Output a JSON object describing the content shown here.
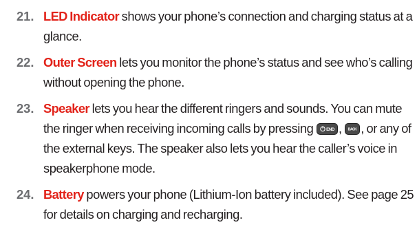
{
  "items": [
    {
      "number": "21.",
      "term": "LED Indicator",
      "text": " shows your phone’s connection and charging status at a glance."
    },
    {
      "number": "22.",
      "term": "Outer Screen",
      "text": " lets you monitor the phone’s status and see who’s calling without opening the phone."
    },
    {
      "number": "23.",
      "term": "Speaker",
      "text_before": " lets you hear the different ringers and sounds. You can mute the ringer when receiving incoming calls by pressing ",
      "key1_label": "END",
      "separator": ", ",
      "key2_label": "BACK",
      "text_after": ", or any of the external keys. The speaker also lets you hear the caller’s voice in speakerphone mode."
    },
    {
      "number": "24.",
      "term": "Battery",
      "text": " powers your phone (Lithium-Ion battery included). See page 25 for details on charging and recharging."
    }
  ],
  "icons": {
    "end_key": "power-end-key-icon",
    "back_key": "back-key-icon"
  },
  "colors": {
    "term": "#e2231a",
    "number": "#6d6e71",
    "body_text": "#231f20",
    "key_fill": "#4a4a4a"
  }
}
